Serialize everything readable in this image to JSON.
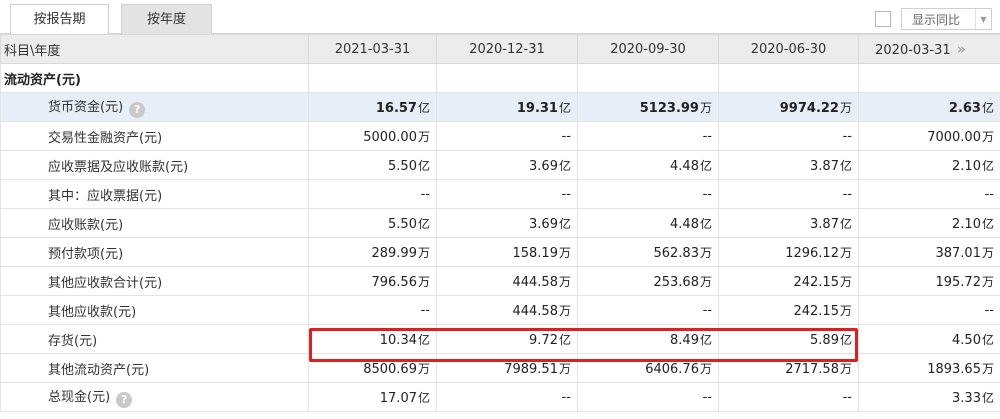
{
  "tabs": [
    {
      "label": "按报告期"
    },
    {
      "label": "按年度"
    }
  ],
  "yoy": {
    "label": "显示同比",
    "checked": false
  },
  "header": {
    "label": "科目\\年度",
    "dates": [
      "2021-03-31",
      "2020-12-31",
      "2020-09-30",
      "2020-06-30",
      "2020-03-31"
    ],
    "next_icon": "double-chevron-right-icon"
  },
  "section_title": "流动资产(元)",
  "rows": [
    {
      "label": "货币资金(元)",
      "help": true,
      "highlight": true,
      "values": [
        {
          "v": "16.57",
          "u": "亿"
        },
        {
          "v": "19.31",
          "u": "亿"
        },
        {
          "v": "5123.99",
          "u": "万"
        },
        {
          "v": "9974.22",
          "u": "万"
        },
        {
          "v": "2.63",
          "u": "亿"
        }
      ]
    },
    {
      "label": "交易性金融资产(元)",
      "values": [
        {
          "v": "5000.00",
          "u": "万"
        },
        {
          "v": "--",
          "u": ""
        },
        {
          "v": "--",
          "u": ""
        },
        {
          "v": "--",
          "u": ""
        },
        {
          "v": "7000.00",
          "u": "万"
        }
      ]
    },
    {
      "label": "应收票据及应收账款(元)",
      "values": [
        {
          "v": "5.50",
          "u": "亿"
        },
        {
          "v": "3.69",
          "u": "亿"
        },
        {
          "v": "4.48",
          "u": "亿"
        },
        {
          "v": "3.87",
          "u": "亿"
        },
        {
          "v": "2.10",
          "u": "亿"
        }
      ]
    },
    {
      "label": "其中：应收票据(元)",
      "values": [
        {
          "v": "--",
          "u": ""
        },
        {
          "v": "--",
          "u": ""
        },
        {
          "v": "--",
          "u": ""
        },
        {
          "v": "--",
          "u": ""
        },
        {
          "v": "--",
          "u": ""
        }
      ]
    },
    {
      "label": "应收账款(元)",
      "values": [
        {
          "v": "5.50",
          "u": "亿"
        },
        {
          "v": "3.69",
          "u": "亿"
        },
        {
          "v": "4.48",
          "u": "亿"
        },
        {
          "v": "3.87",
          "u": "亿"
        },
        {
          "v": "2.10",
          "u": "亿"
        }
      ]
    },
    {
      "label": "预付款项(元)",
      "values": [
        {
          "v": "289.99",
          "u": "万"
        },
        {
          "v": "158.19",
          "u": "万"
        },
        {
          "v": "562.83",
          "u": "万"
        },
        {
          "v": "1296.12",
          "u": "万"
        },
        {
          "v": "387.01",
          "u": "万"
        }
      ]
    },
    {
      "label": "其他应收款合计(元)",
      "values": [
        {
          "v": "796.56",
          "u": "万"
        },
        {
          "v": "444.58",
          "u": "万"
        },
        {
          "v": "253.68",
          "u": "万"
        },
        {
          "v": "242.15",
          "u": "万"
        },
        {
          "v": "195.72",
          "u": "万"
        }
      ]
    },
    {
      "label": "其他应收款(元)",
      "values": [
        {
          "v": "--",
          "u": ""
        },
        {
          "v": "444.58",
          "u": "万"
        },
        {
          "v": "--",
          "u": ""
        },
        {
          "v": "242.15",
          "u": "万"
        },
        {
          "v": "--",
          "u": ""
        }
      ]
    },
    {
      "label": "存货(元)",
      "values": [
        {
          "v": "10.34",
          "u": "亿"
        },
        {
          "v": "9.72",
          "u": "亿"
        },
        {
          "v": "8.49",
          "u": "亿"
        },
        {
          "v": "5.89",
          "u": "亿"
        },
        {
          "v": "4.50",
          "u": "亿"
        }
      ]
    },
    {
      "label": "其他流动资产(元)",
      "values": [
        {
          "v": "8500.69",
          "u": "万"
        },
        {
          "v": "7989.51",
          "u": "万"
        },
        {
          "v": "6406.76",
          "u": "万"
        },
        {
          "v": "2717.58",
          "u": "万"
        },
        {
          "v": "1893.65",
          "u": "万"
        }
      ]
    },
    {
      "label": "总现金(元)",
      "help": true,
      "values": [
        {
          "v": "17.07",
          "u": "亿"
        },
        {
          "v": "--",
          "u": ""
        },
        {
          "v": "--",
          "u": ""
        },
        {
          "v": "--",
          "u": ""
        },
        {
          "v": "3.33",
          "u": "亿"
        }
      ]
    }
  ],
  "help_glyph": "?",
  "colors": {
    "highlight_row": "#e7eef7",
    "annotation_box": "#e02020",
    "header_bg": "#ececec"
  }
}
